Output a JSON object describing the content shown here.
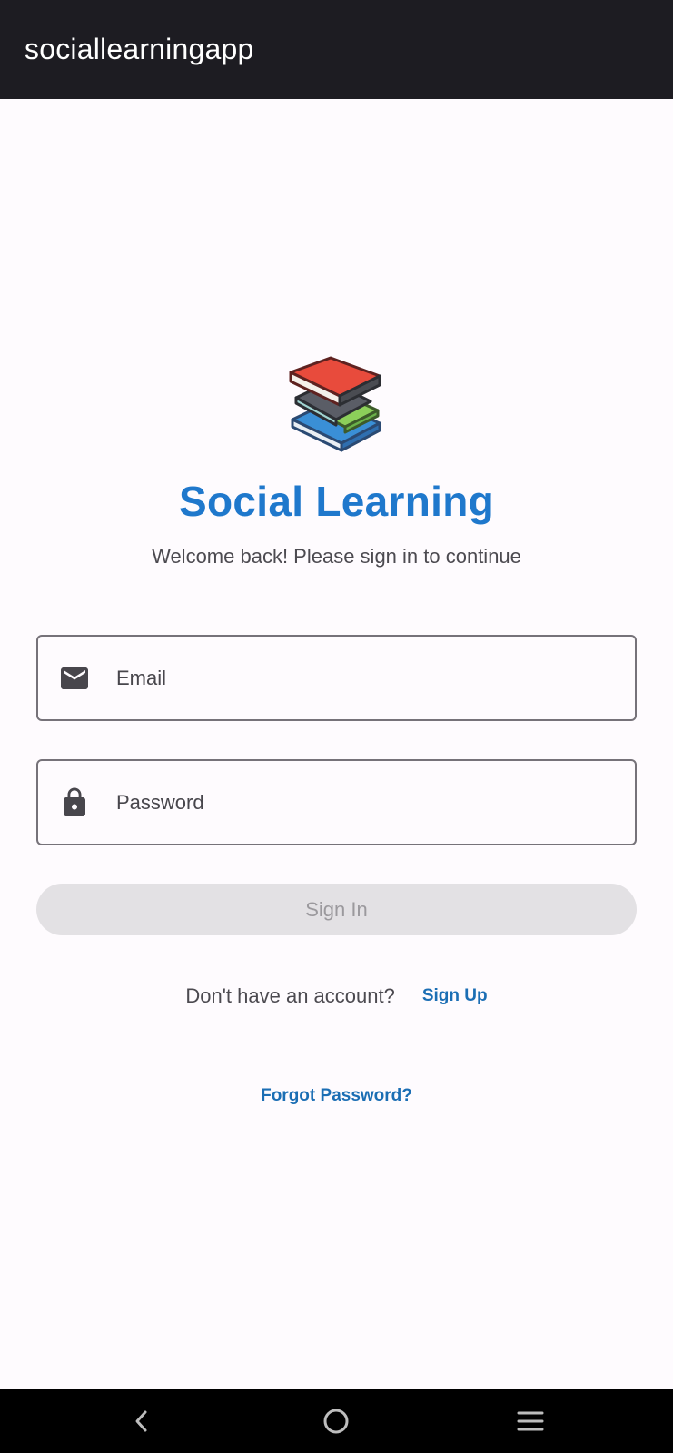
{
  "app_bar": {
    "title": "sociallearningapp"
  },
  "logo": {
    "icon": "books-icon"
  },
  "header": {
    "title": "Social Learning",
    "subtitle": "Welcome back! Please sign in to continue"
  },
  "form": {
    "email": {
      "placeholder": "Email",
      "value": "",
      "icon": "mail-icon"
    },
    "password": {
      "placeholder": "Password",
      "value": "",
      "icon": "lock-icon"
    },
    "signin_label": "Sign In"
  },
  "signup": {
    "prompt": "Don't have an account?",
    "link_label": "Sign Up"
  },
  "forgot": {
    "link_label": "Forgot Password?"
  },
  "nav": {
    "back_icon": "back-icon",
    "home_icon": "home-icon",
    "recents_icon": "menu-icon"
  },
  "colors": {
    "brand": "#1f78cc",
    "link": "#1b6eb4",
    "app_bar_bg": "#1d1c22",
    "disabled_button_bg": "#e3e1e4"
  }
}
